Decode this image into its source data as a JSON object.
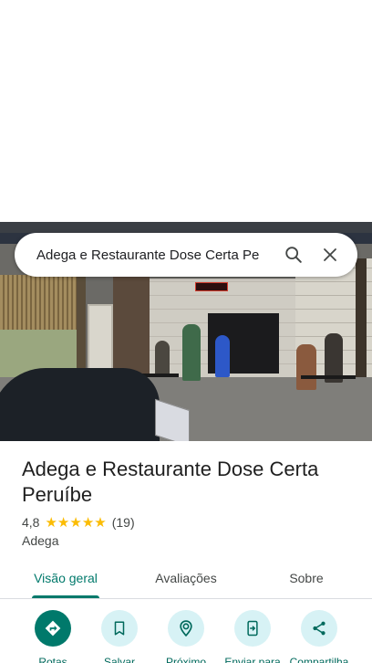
{
  "search": {
    "query": "Adega e Restaurante Dose Certa Pe"
  },
  "place": {
    "name_line1": "Adega e Restaurante Dose Certa",
    "name_line2": "Peruíbe",
    "rating": "4,8",
    "stars": 5,
    "review_count": "(19)",
    "category": "Adega"
  },
  "tabs": [
    {
      "label": "Visão geral",
      "active": true
    },
    {
      "label": "Avaliações",
      "active": false
    },
    {
      "label": "Sobre",
      "active": false
    }
  ],
  "actions": [
    {
      "label": "Rotas",
      "icon": "directions-icon"
    },
    {
      "label": "Salvar",
      "icon": "bookmark-icon"
    },
    {
      "label": "Próximo",
      "icon": "nearby-icon"
    },
    {
      "label": "Enviar para",
      "icon": "send-to-phone-icon"
    },
    {
      "label": "Compartilha",
      "icon": "share-icon"
    }
  ],
  "colors": {
    "accent": "#00796b",
    "action_bg": "#d7f2f5",
    "star": "#fbbc04"
  }
}
